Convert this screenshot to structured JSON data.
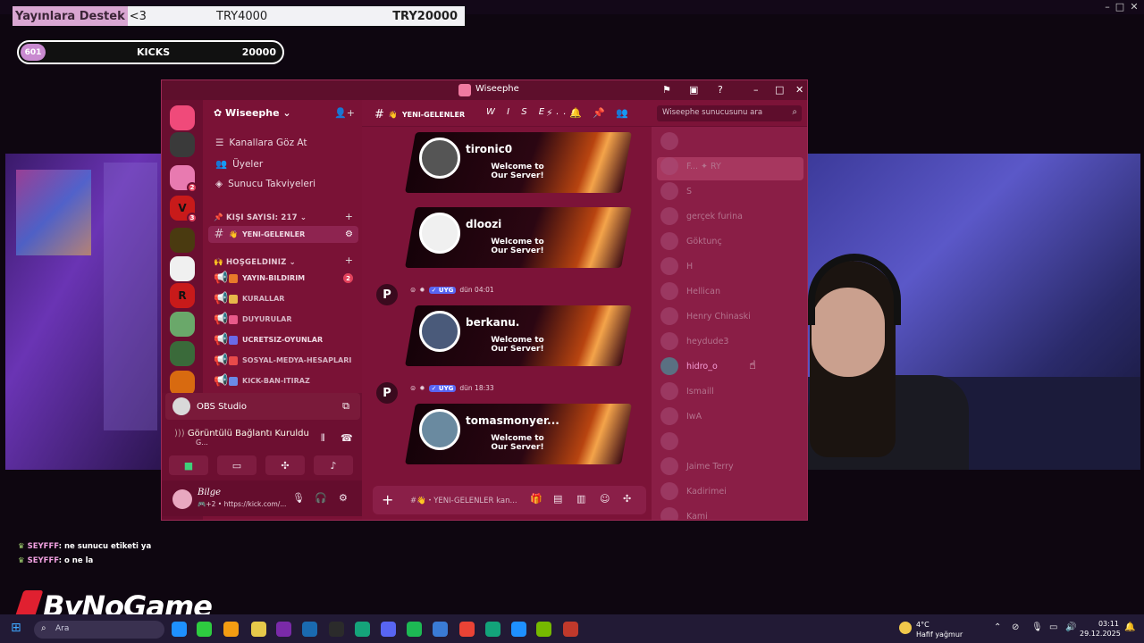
{
  "overlay": {
    "donation_label": "Yayınlara Destek",
    "donation_suffix": "<3",
    "donation_current": "TRY4000",
    "donation_goal": "TRY20000",
    "kicks_count": "601",
    "kicks_label": "KICKS",
    "kicks_goal": "20000"
  },
  "window": {
    "title": "Wiseephe",
    "controls": [
      "–",
      "□",
      "✕"
    ]
  },
  "servers": [
    {
      "abbr": "",
      "color": "#f04a7a"
    },
    {
      "abbr": "",
      "color": "#3a3a3a",
      "badge": ""
    },
    {
      "abbr": "",
      "color": "#e87ab0",
      "badge": "2"
    },
    {
      "abbr": "V",
      "color": "#c81a1a",
      "badge": "3"
    },
    {
      "abbr": "",
      "color": "#4a3a10"
    },
    {
      "abbr": "",
      "color": "#f0f0f0"
    },
    {
      "abbr": "R",
      "color": "#c81a1a"
    },
    {
      "abbr": "",
      "color": "#6aa86a"
    },
    {
      "abbr": "",
      "color": "#3a6a3a"
    },
    {
      "abbr": "",
      "color": "#d86a10"
    }
  ],
  "sidebar": {
    "server_name": "Wiseephe",
    "links": [
      "Kanallara Göz At",
      "Üyeler",
      "Sunucu Takviyeleri"
    ],
    "category1": "KIŞI SAYISI: 217",
    "active_channel": "YENI-GELENLER",
    "category2": "HOŞGELDINIZ",
    "channels": [
      {
        "name": "YAYIN-BILDIRIM",
        "count": "2",
        "bold": true
      },
      {
        "name": "KURALLAR",
        "count": "",
        "bold": false
      },
      {
        "name": "DUYURULAR",
        "count": "",
        "bold": false
      },
      {
        "name": "UCRETSIZ-OYUNLAR",
        "count": "",
        "bold": true
      },
      {
        "name": "SOSYAL-MEDYA-HESAPLARI",
        "count": "",
        "bold": false
      },
      {
        "name": "KICK-BAN-ITIRAZ",
        "count": "",
        "bold": false
      }
    ]
  },
  "voice": {
    "stream_name": "OBS Studio",
    "status": "Görüntülü Bağlantı Kuruldu",
    "status_sub": "G..."
  },
  "user": {
    "name": "Bilge",
    "status": "🎮+2 • https://kick.com/..."
  },
  "chat_header": {
    "channel": "YENI-GELENLER",
    "decor": "W I S E ...",
    "search_placeholder": "Wiseephe sunucusunu ara"
  },
  "messages": [
    {
      "user": "tironic0",
      "welcome": "Welcome to Our Server!",
      "meta": false
    },
    {
      "user": "dloozi",
      "welcome": "Welcome to Our Server!",
      "meta": false
    },
    {
      "user": "berkanu.",
      "welcome": "Welcome to Our Server!",
      "meta": true,
      "tag": "✓ UYG",
      "time": "dün 04:01"
    },
    {
      "user": "tomasmonyer...",
      "welcome": "Welcome to Our Server!",
      "meta": true,
      "tag": "✓ UYG",
      "time": "dün 18:33"
    }
  ],
  "composer": {
    "placeholder": "#👋・YENI-GELENLER kan..."
  },
  "members": [
    "",
    "F... ✦ RY",
    "S",
    "gerçek furina",
    "Göktunç",
    "H",
    "Hellican",
    "Henry Chinaski",
    "heydude3",
    "hidro_o",
    "Ismaill",
    "IwA",
    "",
    "Jaime Terry",
    "Kadirimei",
    "Kami"
  ],
  "members_online": "hidro_o",
  "chat_overlay": [
    {
      "who": "SEYFFF",
      "text": ": ne sunucu etiketi ya"
    },
    {
      "who": "SEYFFF",
      "text": ": o ne la"
    }
  ],
  "brand": "ByNoGame",
  "taskbar": {
    "search_label": "Ara",
    "weather_temp": "4°C",
    "weather_desc": "Hafif yağmur",
    "time": "03:11",
    "date": "29.12.2025",
    "apps": [
      "#1e90ff",
      "#2ecc40",
      "#f39c12",
      "#e6c84a",
      "#7a2aa8",
      "#1a6ab0",
      "#2b2b2b",
      "#15a37a",
      "#5865f2",
      "#1db954",
      "#3a7bd5",
      "#ea4335",
      "#13a37a",
      "#1e90ff",
      "#76b900",
      "#c0392b"
    ]
  }
}
